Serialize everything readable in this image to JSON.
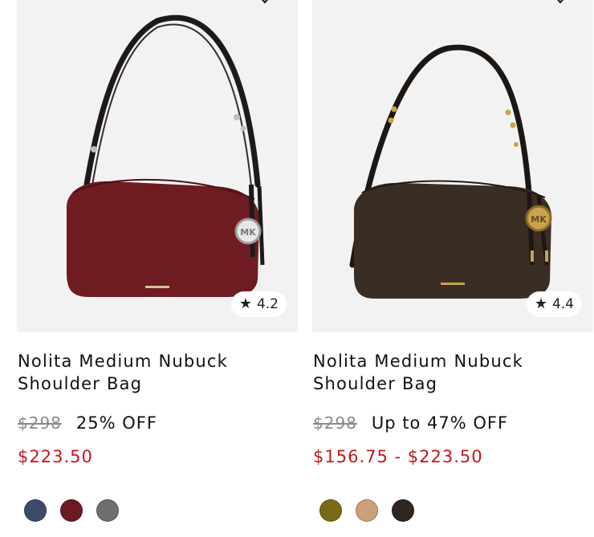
{
  "products": [
    {
      "name": "Nolita Medium Nubuck Shoulder Bag",
      "rating": "4.2",
      "original_price": "$298",
      "discount": "25% OFF",
      "sale_price": "$223.50",
      "bag_color": "#6e1b22",
      "hardware_color": "silver",
      "swatches": [
        "#3f4a6b",
        "#6b1a24",
        "#6e6e6e"
      ]
    },
    {
      "name": "Nolita Medium Nubuck Shoulder Bag",
      "rating": "4.4",
      "original_price": "$298",
      "discount": "Up to 47% OFF",
      "sale_price": "$156.75 - $223.50",
      "bag_color": "#3a2d24",
      "hardware_color": "gold",
      "swatches": [
        "#7a6a17",
        "#c9a07a",
        "#2f2521"
      ]
    }
  ]
}
